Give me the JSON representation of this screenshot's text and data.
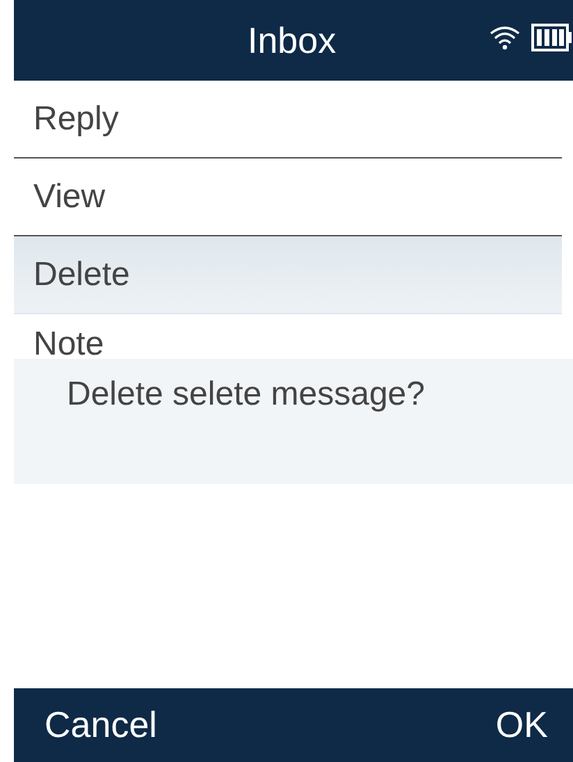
{
  "header": {
    "title": "Inbox"
  },
  "menu": [
    {
      "label": "Reply",
      "selected": false
    },
    {
      "label": "View",
      "selected": false
    },
    {
      "label": "Delete",
      "selected": true
    },
    {
      "label": "Note",
      "selected": false
    }
  ],
  "dialog": {
    "message": "Delete selete message?"
  },
  "softkeys": {
    "left": "Cancel",
    "right": "OK"
  }
}
